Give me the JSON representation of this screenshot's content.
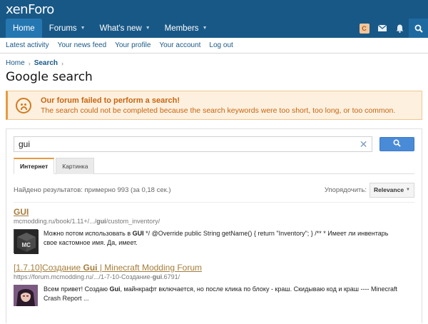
{
  "header": {
    "logo": "xenForo"
  },
  "nav": {
    "tabs": [
      {
        "label": "Home",
        "has_menu": false
      },
      {
        "label": "Forums",
        "has_menu": true
      },
      {
        "label": "What's new",
        "has_menu": true
      },
      {
        "label": "Members",
        "has_menu": true
      }
    ],
    "avatar_letter": "C",
    "icons": [
      "avatar",
      "envelope-icon",
      "bell-icon",
      "search-icon"
    ]
  },
  "subnav": {
    "links": [
      "Latest activity",
      "Your news feed",
      "Your profile",
      "Your account",
      "Log out"
    ]
  },
  "breadcrumb": {
    "home": "Home",
    "current": "Search"
  },
  "page_title": "Google search",
  "error": {
    "title": "Our forum failed to perform a search!",
    "message": "The search could not be completed because the search keywords were too short, too long, or too common."
  },
  "search": {
    "query": "gui",
    "tabs": [
      "Интернет",
      "Картинка"
    ],
    "active_tab": "Интернет",
    "result_count": "Найдено результатов: примерно 993 (за 0,18 сек.)",
    "sort_label": "Упорядочить:",
    "sort_value": "Relevance"
  },
  "results": [
    {
      "title_parts": [
        {
          "t": "GUI",
          "b": true
        }
      ],
      "url_parts": [
        {
          "t": "mcmodding.ru/book/1.11+/.../",
          "b": false
        },
        {
          "t": "gui",
          "b": true
        },
        {
          "t": "/custom_inventory/",
          "b": false
        }
      ],
      "snippet_parts": [
        {
          "t": "Можно потом использовать в ",
          "b": false
        },
        {
          "t": "GUI",
          "b": true
        },
        {
          "t": " */ @Override public String getName() { return \"Inventory\"; } /** * Имеет ли инвентарь свое кастомное имя. Да, имеет.",
          "b": false
        }
      ],
      "thumb": "minecraft-cube-icon",
      "thumb_letters": "MC"
    },
    {
      "title_parts": [
        {
          "t": "[1.7.10]Создание ",
          "b": false
        },
        {
          "t": "Gui",
          "b": true
        },
        {
          "t": " | Minecraft Modding Forum",
          "b": false
        }
      ],
      "url_parts": [
        {
          "t": "https://forum.mcmodding.ru/.../1-7-10-Создание-",
          "b": false
        },
        {
          "t": "gui",
          "b": true
        },
        {
          "t": ".6791/",
          "b": false
        }
      ],
      "snippet_parts": [
        {
          "t": "Всем привет! Создаю ",
          "b": false
        },
        {
          "t": "Gui",
          "b": true
        },
        {
          "t": ", майнкрафт включается, но после клика по блоку - краш. Скидываю код и краш ---- Minecraft Crash Report ...",
          "b": false
        }
      ],
      "thumb": "anime-character-image"
    }
  ],
  "colors": {
    "nav_bg": "#185886",
    "nav_active": "#2577b1",
    "link": "#185886",
    "error_text": "#c8650f",
    "error_bg": "#fdf0df",
    "result_title": "#a47d3c",
    "search_button": "#4a8bd8"
  }
}
